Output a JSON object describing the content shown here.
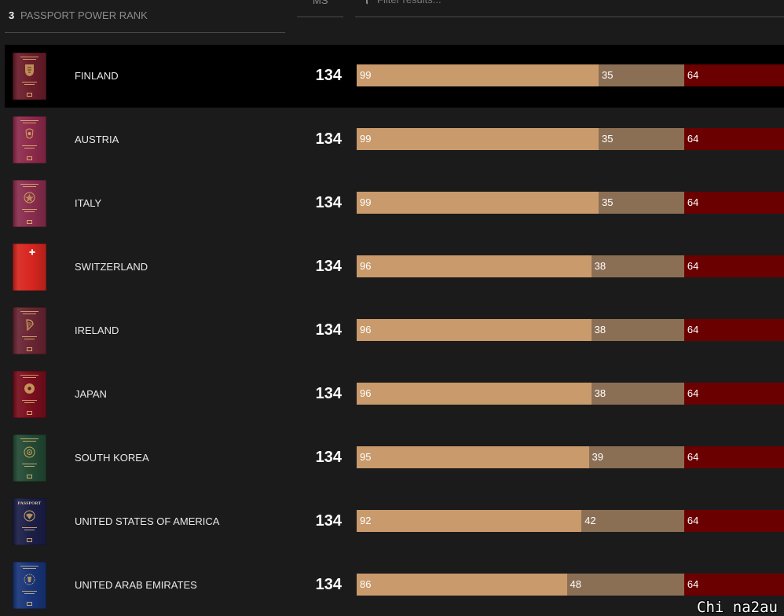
{
  "header": {
    "rank_number": "3",
    "rank_label": "PASSPORT POWER RANK",
    "ms_label": "MS",
    "filter": {
      "icon": "filter-icon",
      "placeholder": "Filter results...",
      "value": ""
    }
  },
  "colors": {
    "background": "#1b1b1b",
    "highlight_row": "#000000",
    "text": "#e8e8e8",
    "muted_text": "#8c8c8c",
    "segment_1": "#c99a6b",
    "segment_2": "#8b6f55",
    "segment_3": "#6b0000"
  },
  "rows": [
    {
      "country": "FINLAND",
      "score": 134,
      "segments": [
        99,
        35,
        64
      ],
      "highlighted": true,
      "passport": {
        "color": "#6b1d2a",
        "emblem": "lion-crest-icon"
      }
    },
    {
      "country": "AUSTRIA",
      "score": 134,
      "segments": [
        99,
        35,
        64
      ],
      "highlighted": false,
      "passport": {
        "color": "#8e2a4c",
        "emblem": "eagle-crest-icon"
      }
    },
    {
      "country": "ITALY",
      "score": 134,
      "segments": [
        99,
        35,
        64
      ],
      "highlighted": false,
      "passport": {
        "color": "#8a2d4e",
        "emblem": "star-emblem-icon"
      }
    },
    {
      "country": "SWITZERLAND",
      "score": 134,
      "segments": [
        96,
        38,
        64
      ],
      "highlighted": false,
      "passport": {
        "color": "#d8261f",
        "emblem": "swiss-cross-icon"
      }
    },
    {
      "country": "IRELAND",
      "score": 134,
      "segments": [
        96,
        38,
        64
      ],
      "highlighted": false,
      "passport": {
        "color": "#6a2533",
        "emblem": "harp-icon"
      }
    },
    {
      "country": "JAPAN",
      "score": 134,
      "segments": [
        96,
        38,
        64
      ],
      "highlighted": false,
      "passport": {
        "color": "#7a0e1e",
        "emblem": "chrysanthemum-icon"
      }
    },
    {
      "country": "SOUTH KOREA",
      "score": 134,
      "segments": [
        95,
        39,
        64
      ],
      "highlighted": false,
      "passport": {
        "color": "#234a34",
        "emblem": "hibiscus-emblem-icon"
      }
    },
    {
      "country": "UNITED STATES OF AMERICA",
      "score": 134,
      "segments": [
        92,
        42,
        64
      ],
      "highlighted": false,
      "passport": {
        "color": "#1b1f48",
        "emblem": "eagle-seal-icon",
        "cover_text": "PASSPORT"
      }
    },
    {
      "country": "UNITED ARAB EMIRATES",
      "score": 134,
      "segments": [
        86,
        48,
        64
      ],
      "highlighted": false,
      "passport": {
        "color": "#18357a",
        "emblem": "falcon-emblem-icon"
      }
    }
  ],
  "watermark": "Chi na2au"
}
